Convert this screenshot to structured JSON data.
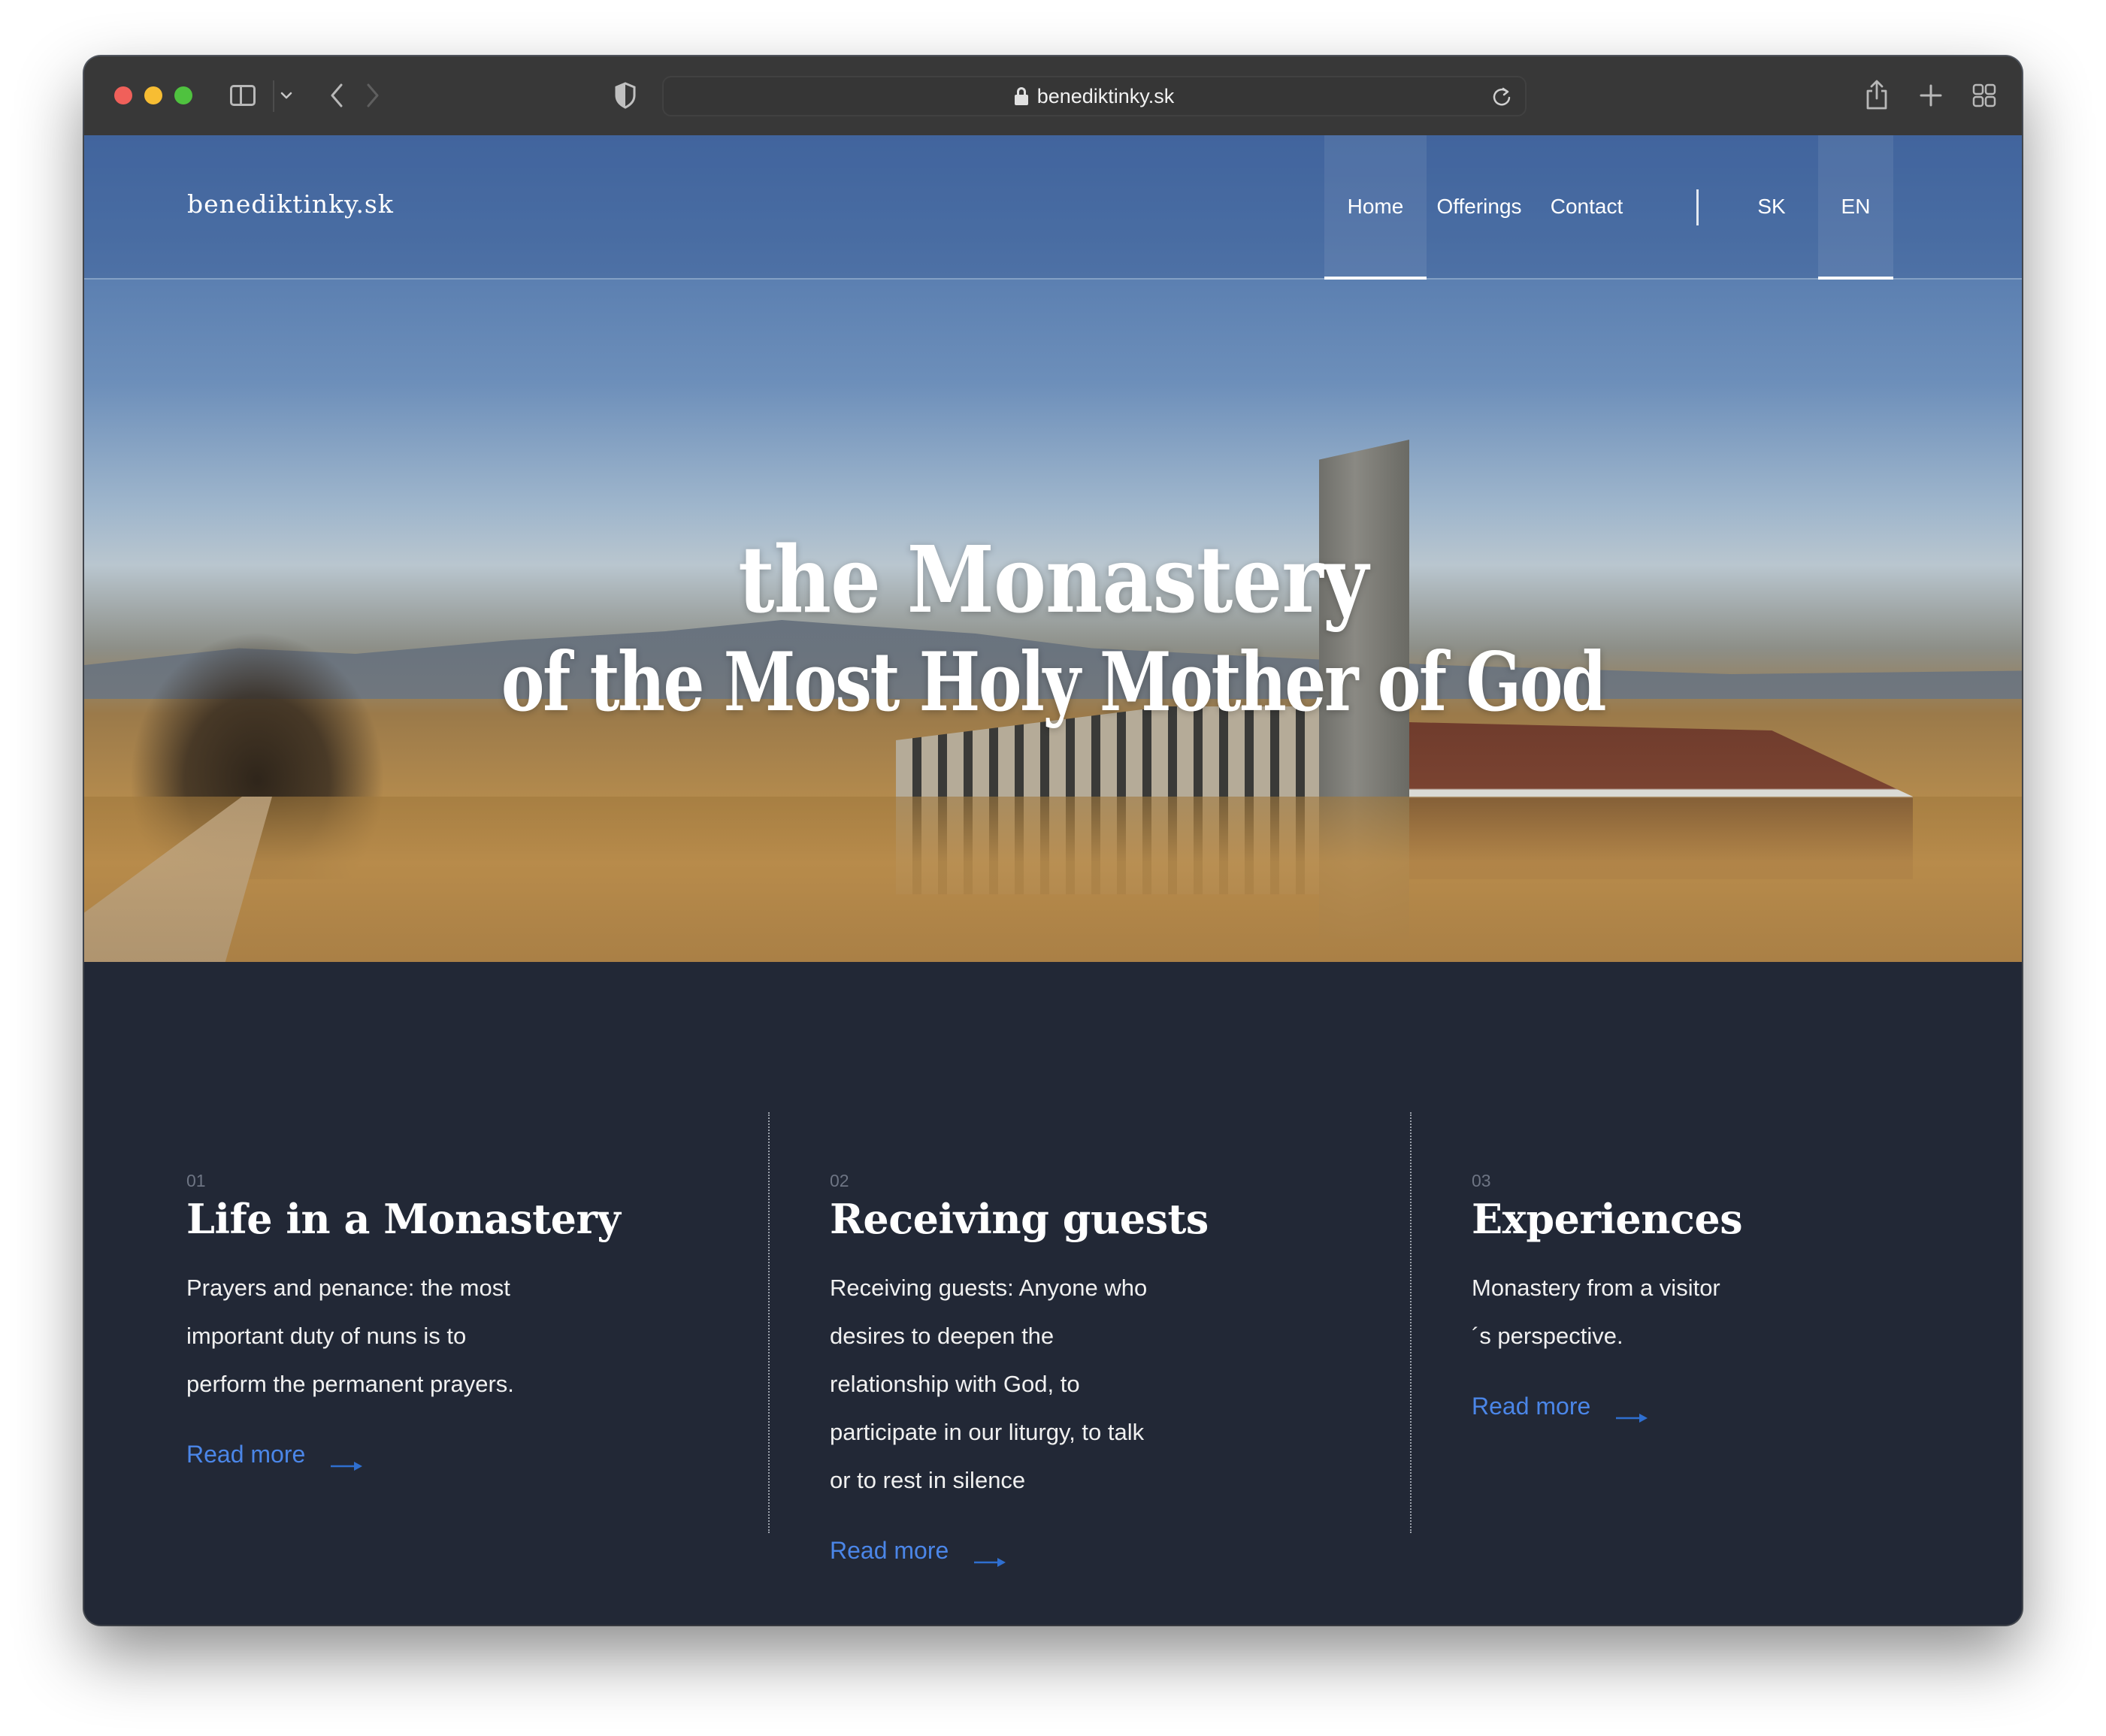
{
  "browser": {
    "url": "benediktinky.sk",
    "icons": {
      "sidebar": "sidebar-icon",
      "sidebar_menu": "chevron-down-icon",
      "back": "chevron-left-icon",
      "forward": "chevron-right-icon",
      "privacy": "shield-icon",
      "lock": "lock-icon",
      "reload": "reload-icon",
      "share": "share-icon",
      "new_tab": "plus-icon",
      "tab_overview": "grid-icon"
    }
  },
  "site": {
    "logo": "benediktinky.sk",
    "nav": [
      {
        "label": "Home",
        "active": true
      },
      {
        "label": "Offerings",
        "active": false
      },
      {
        "label": "Contact",
        "active": false
      }
    ],
    "languages": [
      {
        "label": "SK",
        "active": false
      },
      {
        "label": "EN",
        "active": true
      }
    ]
  },
  "hero": {
    "title_line1": "the Monastery",
    "title_line2": "of the Most Holy Mother of God"
  },
  "sections": [
    {
      "number": "01",
      "title": "Life in a Monastery",
      "body_lines": [
        "Prayers and penance: the most",
        "important duty of nuns is to",
        "perform the permanent prayers."
      ],
      "link": "Read more"
    },
    {
      "number": "02",
      "title": "Receiving guests",
      "body_lines": [
        "Receiving guests: Anyone who",
        "desires to deepen the",
        "relationship with God, to",
        "participate in our liturgy, to talk",
        "or to rest in silence"
      ],
      "link": "Read more"
    },
    {
      "number": "03",
      "title": "Experiences",
      "body_lines": [
        "Monastery from a visitor",
        "´s perspective."
      ],
      "link": "Read more"
    }
  ],
  "colors": {
    "content_bg": "#222836",
    "link": "#4b86e8",
    "toolbar_bg": "#383838",
    "section_number": "#6e7584"
  }
}
